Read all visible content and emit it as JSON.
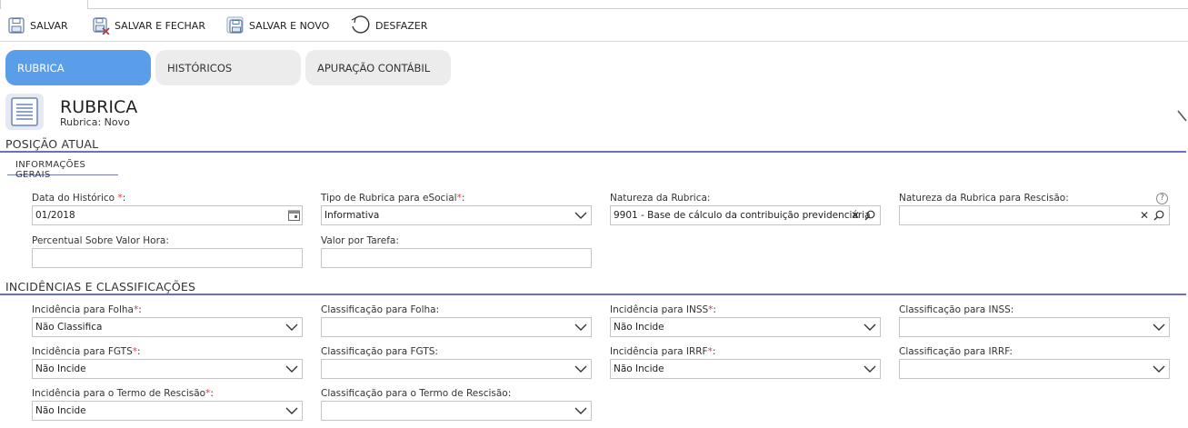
{
  "toolbar": {
    "save": "SALVAR",
    "save_close": "SALVAR E FECHAR",
    "save_new": "SALVAR E NOVO",
    "undo": "DESFAZER"
  },
  "tabs": [
    {
      "label": "RUBRICA",
      "active": true
    },
    {
      "label": "HISTÓRICOS",
      "active": false
    },
    {
      "label": "APURAÇÃO CONTÁBIL",
      "active": false
    }
  ],
  "header": {
    "title": "RUBRICA",
    "subtitle": "Rubrica: Novo"
  },
  "sections": {
    "posicao_atual": "POSIÇÃO ATUAL",
    "info_gerais": "INFORMAÇÕES GERAIS",
    "incidencias": "INCIDÊNCIAS E CLASSIFICAÇÕES"
  },
  "fields": {
    "data_historico": {
      "label": "Data do Histórico ",
      "req": "*",
      "colon": ":",
      "value": "01/2018"
    },
    "tipo_rubrica": {
      "label": "Tipo de Rubrica para eSocial",
      "req": "*",
      "colon": ":",
      "value": "Informativa"
    },
    "natureza": {
      "label": "Natureza da Rubrica:",
      "value": "9901 - Base de cálculo da contribuição previdenciária"
    },
    "natureza_rescisao": {
      "label": "Natureza da Rubrica para Rescisão:",
      "value": ""
    },
    "percentual": {
      "label": "Percentual Sobre Valor Hora:",
      "value": ""
    },
    "valor_tarefa": {
      "label": "Valor por Tarefa:",
      "value": ""
    },
    "inc_folha": {
      "label": "Incidência para Folha",
      "req": "*",
      "colon": ":",
      "value": "Não Classifica"
    },
    "class_folha": {
      "label": "Classificação para Folha:",
      "value": ""
    },
    "inc_inss": {
      "label": "Incidência para INSS",
      "req": "*",
      "colon": ":",
      "value": "Não Incide"
    },
    "class_inss": {
      "label": "Classificação para INSS:",
      "value": ""
    },
    "inc_fgts": {
      "label": "Incidência para FGTS",
      "req": "*",
      "colon": ":",
      "value": "Não Incide"
    },
    "class_fgts": {
      "label": "Classificação para FGTS:",
      "value": ""
    },
    "inc_irrf": {
      "label": "Incidência para IRRF",
      "req": "*",
      "colon": ":",
      "value": "Não Incide"
    },
    "class_irrf": {
      "label": "Classificação para IRRF:",
      "value": ""
    },
    "inc_rescisao": {
      "label": "Incidência para o Termo de Rescisão",
      "req": "*",
      "colon": ":",
      "value": "Não Incide"
    },
    "class_rescisao": {
      "label": "Classificação para o Termo de Rescisão:",
      "value": ""
    }
  },
  "help_symbol": "?",
  "clear_symbol": "✕",
  "colors": {
    "accent": "#5a9ee9",
    "section_line": "#6b6fc4",
    "required": "#e03c3c"
  }
}
